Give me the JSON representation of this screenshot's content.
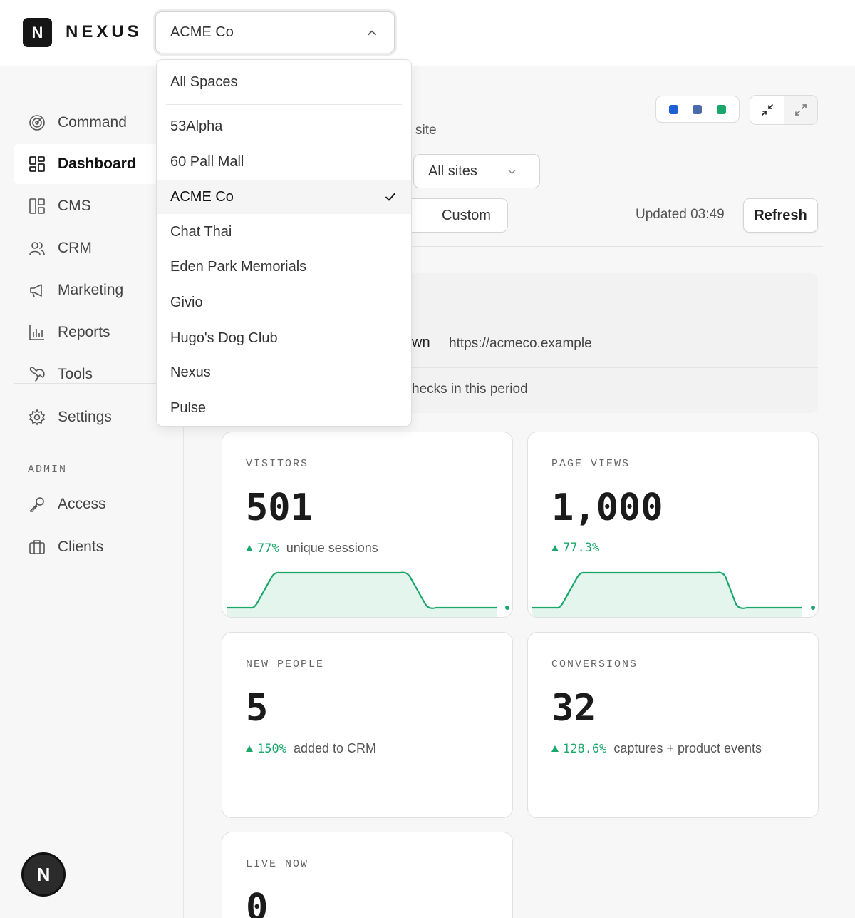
{
  "brand": {
    "logo_letter": "N",
    "name": "NEXUS"
  },
  "space_select": {
    "value": "ACME Co"
  },
  "sidebar": {
    "items": [
      {
        "label": "Command",
        "icon": "radar-icon"
      },
      {
        "label": "Dashboard",
        "icon": "grid-icon",
        "active": true
      },
      {
        "label": "CMS",
        "icon": "layout-icon"
      },
      {
        "label": "CRM",
        "icon": "users-icon"
      },
      {
        "label": "Marketing",
        "icon": "megaphone-icon"
      },
      {
        "label": "Reports",
        "icon": "bar-chart-icon"
      },
      {
        "label": "Tools",
        "icon": "wrench-icon"
      },
      {
        "label": "Settings",
        "icon": "gear-icon"
      }
    ],
    "admin_label": "ADMIN",
    "admin_items": [
      {
        "label": "Access",
        "icon": "key-icon"
      },
      {
        "label": "Clients",
        "icon": "briefcase-icon"
      }
    ]
  },
  "fab": {
    "letter": "N"
  },
  "toolbar": {
    "dot_colors": [
      "#1f5fd6",
      "#4a6aa8",
      "#1aa86a"
    ],
    "site_text": "site",
    "site_select": "All sites",
    "range_custom": "Custom",
    "updated": "Updated 03:49",
    "refresh": "Refresh"
  },
  "info": {
    "row_label": "wn",
    "url": "https://acmeco.example",
    "checks": "hecks in this period"
  },
  "cards": [
    {
      "label": "VISITORS",
      "value": "501",
      "delta": "77%",
      "note": "unique sessions",
      "sparkline": true
    },
    {
      "label": "PAGE VIEWS",
      "value": "1,000",
      "delta": "77.3%",
      "note": "",
      "sparkline": true
    },
    {
      "label": "NEW PEOPLE",
      "value": "5",
      "delta": "150%",
      "note": "added to CRM"
    },
    {
      "label": "CONVERSIONS",
      "value": "32",
      "delta": "128.6%",
      "note": "captures + product events"
    },
    {
      "label": "LIVE NOW",
      "value": "0"
    }
  ],
  "dropdown": {
    "first": "All Spaces",
    "options": [
      "53Alpha",
      "60 Pall Mall",
      "ACME Co",
      "Chat Thai",
      "Eden Park Memorials",
      "Givio",
      "Hugo's Dog Club",
      "Nexus",
      "Pulse"
    ],
    "selected": "ACME Co"
  },
  "colors": {
    "accent_green": "#1aa86a",
    "spark_fill": "#e3f5ec"
  }
}
